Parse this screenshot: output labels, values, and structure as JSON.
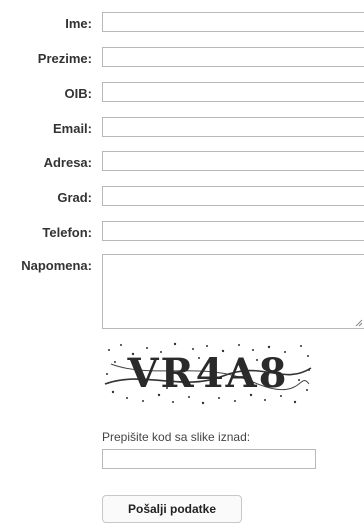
{
  "form": {
    "fields": [
      {
        "label": "Ime:",
        "value": ""
      },
      {
        "label": "Prezime:",
        "value": ""
      },
      {
        "label": "OIB:",
        "value": ""
      },
      {
        "label": "Email:",
        "value": ""
      },
      {
        "label": "Adresa:",
        "value": ""
      },
      {
        "label": "Grad:",
        "value": ""
      },
      {
        "label": "Telefon:",
        "value": ""
      }
    ],
    "napomena": {
      "label": "Napomena:",
      "value": ""
    },
    "captcha": {
      "code": "VR4A8",
      "hint": "Prepišite kod sa slike iznad:",
      "value": ""
    },
    "submit_label": "Pošalji podatke"
  }
}
